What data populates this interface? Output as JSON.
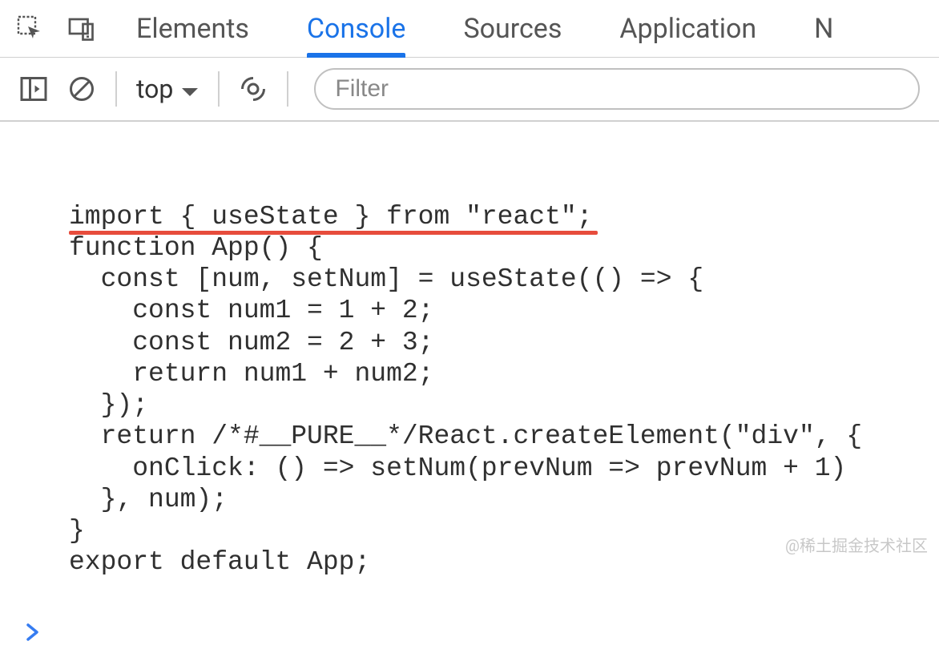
{
  "tabs": {
    "elements": "Elements",
    "console": "Console",
    "sources": "Sources",
    "application": "Application",
    "overflow": "N"
  },
  "toolbar": {
    "context": "top",
    "filter_placeholder": "Filter"
  },
  "code": {
    "line1": "import { useState } from \"react\";",
    "line2": "function App() {",
    "line3": "  const [num, setNum] = useState(() => {",
    "line4": "    const num1 = 1 + 2;",
    "line5": "    const num2 = 2 + 3;",
    "line6": "    return num1 + num2;",
    "line7": "  });",
    "line8": "  return /*#__PURE__*/React.createElement(\"div\", {",
    "line9": "    onClick: () => setNum(prevNum => prevNum + 1)",
    "line10": "  }, num);",
    "line11": "}",
    "line12": "export default App;"
  },
  "watermark": "@稀土掘金技术社区"
}
